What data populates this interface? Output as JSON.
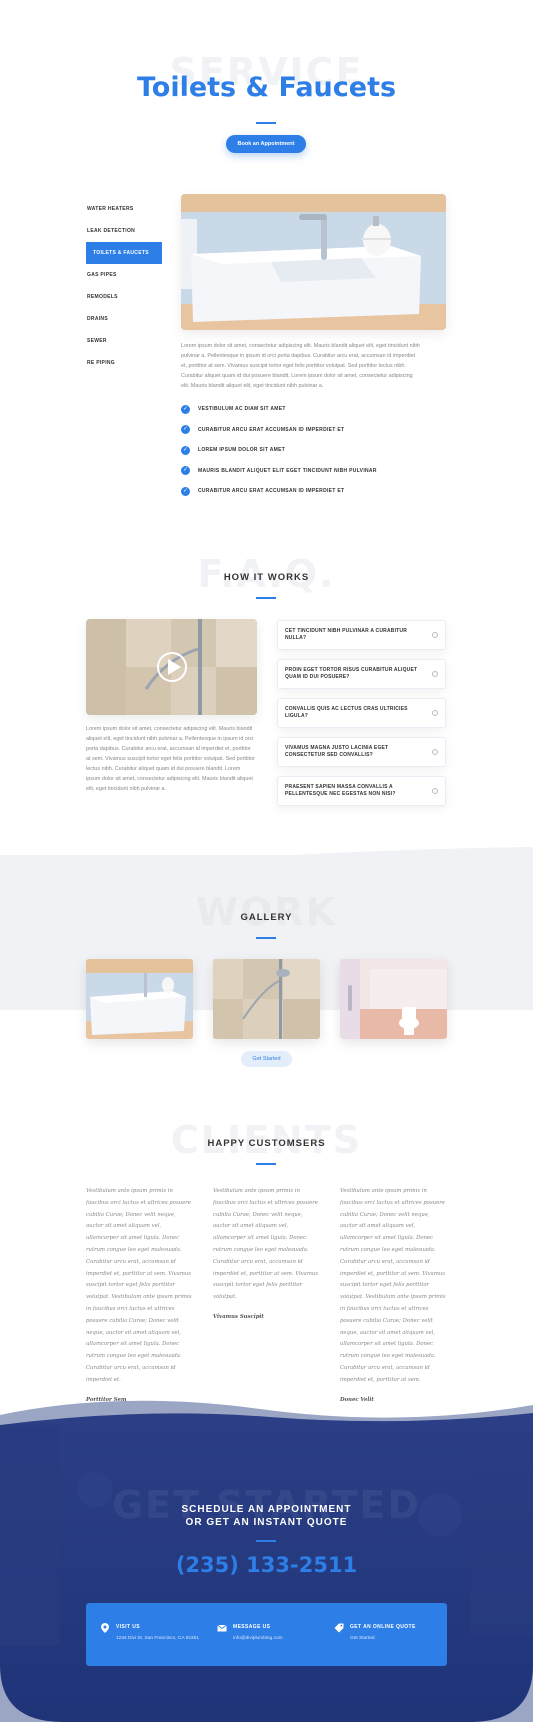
{
  "hero": {
    "ghost_text": "SERVICE",
    "title": "Toilets & Faucets",
    "book_button": "Book an Appointment"
  },
  "service": {
    "menu": [
      {
        "label": "WATER HEATERS"
      },
      {
        "label": "LEAK DETECTION"
      },
      {
        "label": "TOILETS & FAUCETS"
      },
      {
        "label": "GAS PIPES"
      },
      {
        "label": "REMODELS"
      },
      {
        "label": "DRAINS"
      },
      {
        "label": "SEWER"
      },
      {
        "label": "RE PIPING"
      }
    ],
    "active_index": 2,
    "body": "Lorem ipsum dolor sit amet, consectetur adipiscing elit. Mauris blandit aliquet elit, eget tincidunt nibh pulvinar a. Pellentesque in ipsum id orci porta dapibus. Curabitur arcu erat, accumsan id imperdiet et, porttitor at sem. Vivamus suscipit tortor eget felis porttitor volutpat. Sed porttitor lectus nibh. Curabitur aliquet quam id dui posuere blandit. Lorem ipsum dolor sit amet, consectetur adipiscing elit. Mauris blandit aliquet elit, eget tincidunt nibh pulvinar a.",
    "checks": [
      "VESTIBULUM AC DIAM SIT AMET",
      "CURABITUR ARCU ERAT ACCUMSAN ID IMPERDIET ET",
      "LOREM IPSUM DOLOR SIT AMET",
      "MAURIS BLANDIT ALIQUET ELIT EGET TINCIDUNT NIBH PULVINAR",
      "CURABITUR ARCU ERAT ACCUMSAN ID IMPERDIET ET"
    ]
  },
  "how": {
    "ghost_text": "F.A.Q.",
    "title": "HOW IT WORKS",
    "body": "Lorem ipsum dolor sit amet, consectetur adipiscing elit. Mauris blandit aliquet elit, eget tincidunt nibh pulvinar a. Pellentesque in ipsum id orci porta dapibus. Curabitur arcu erat, accumsan id imperdiet et, porttitor at sem. Vivamus suscipit tortor eget felis porttitor volutpat. Sed porttitor lectus nibh. Curabitur aliquet quam id dui posuere blandit. Lorem ipsum dolor sit amet, consectetur adipiscing elit. Mauris blandit aliquet elit, eget tincidunt nibh pulvinar a.",
    "faq": [
      "CET TINCIDUNT NIBH PULVINAR A CURABITUR NULLA?",
      "PROIN EGET TORTOR RISUS CURABITUR ALIQUET QUAM ID DUI POSUERE?",
      "CONVALLIS QUIS AC LECTUS CRAS ULTRICIES LIGULA?",
      "VIVAMUS MAGNA JUSTO LACINIA EGET CONSECTETUR SED CONVALLIS?",
      "PRAESENT SAPIEN MASSA CONVALLIS A PELLENTESQUE NEC EGESTAS NON NISI?"
    ]
  },
  "gallery": {
    "ghost_text": "WORK",
    "title": "GALLERY",
    "button": "Get Started"
  },
  "clients": {
    "ghost_text": "CLIENTS",
    "title": "HAPPY CUSTOMSERS",
    "testimonials": [
      {
        "text": "Vestibulum ante ipsum primis in faucibus orci luctus et ultrices posuere cubilia Curae; Donec velit neque, auctor sit amet aliquam vel, ullamcorper sit amet ligula. Donec rutrum congue leo eget malesuada. Curabitur arcu erat, accumsan id imperdiet et, porttitor at sem. Vivamus suscipit tortor eget felis porttitor volutpat. Vestibulum ante ipsum primis in faucibus orci luctus et ultrices posuere cubilia Curae; Donec velit neque, auctor sit amet aliquam vel, ullamcorper sit amet ligula. Donec rutrum congue leo eget malesuada. Curabitur arcu erat, accumsan id imperdiet et.",
        "name": "Porttitor Sem"
      },
      {
        "text": "Vestibulum ante ipsum primis in faucibus orci luctus et ultrices posuere cubilia Curae; Donec velit neque, auctor sit amet aliquam vel, ullamcorper sit amet ligula. Donec rutrum congue leo eget malesuada. Curabitur arcu erat, accumsan id imperdiet et, porttitor at sem. Vivamus suscipit tortor eget felis porttitor volutpat.",
        "name": "Vivamus Suscipit"
      },
      {
        "text": "Vestibulum ante ipsum primis in faucibus orci luctus et ultrices posuere cubilia Curae; Donec velit neque, auctor sit amet aliquam vel, ullamcorper sit amet ligula. Donec rutrum congue leo eget malesuada. Curabitur arcu erat, accumsan id imperdiet et, porttitor at sem. Vivamus suscipit tortor eget felis porttitor volutpat. Vestibulum ante ipsum primis in faucibus orci luctus et ultrices posuere cubilia Curae; Donec velit neque, auctor sit amet aliquam vel, ullamcorper sit amet ligula. Donec rutrum congue leo eget malesuada. Curabitur arcu erat, accumsan id imperdiet et, porttitor at sem.",
        "name": "Donec Velit"
      }
    ]
  },
  "footer": {
    "ghost_text": "GET STARTED",
    "title_line1": "SCHEDULE AN APPOINTMENT",
    "title_line2": "OR GET AN INSTANT QUOTE",
    "phone": "(235) 133-2511",
    "contacts": [
      {
        "icon": "map-pin-icon",
        "heading": "VISIT US",
        "detail": "1234 Divi St. San Francisco, CA 92351"
      },
      {
        "icon": "envelope-icon",
        "heading": "MESSAGE US",
        "detail": "info@diviplumbing.com"
      },
      {
        "icon": "tag-icon",
        "heading": "GET AN ONLINE QUOTE",
        "detail": "Get Started"
      }
    ]
  },
  "colors": {
    "accent": "#2d7ee6",
    "footer_bg": "#23397f",
    "gallery_band": "#f1f2f5"
  }
}
